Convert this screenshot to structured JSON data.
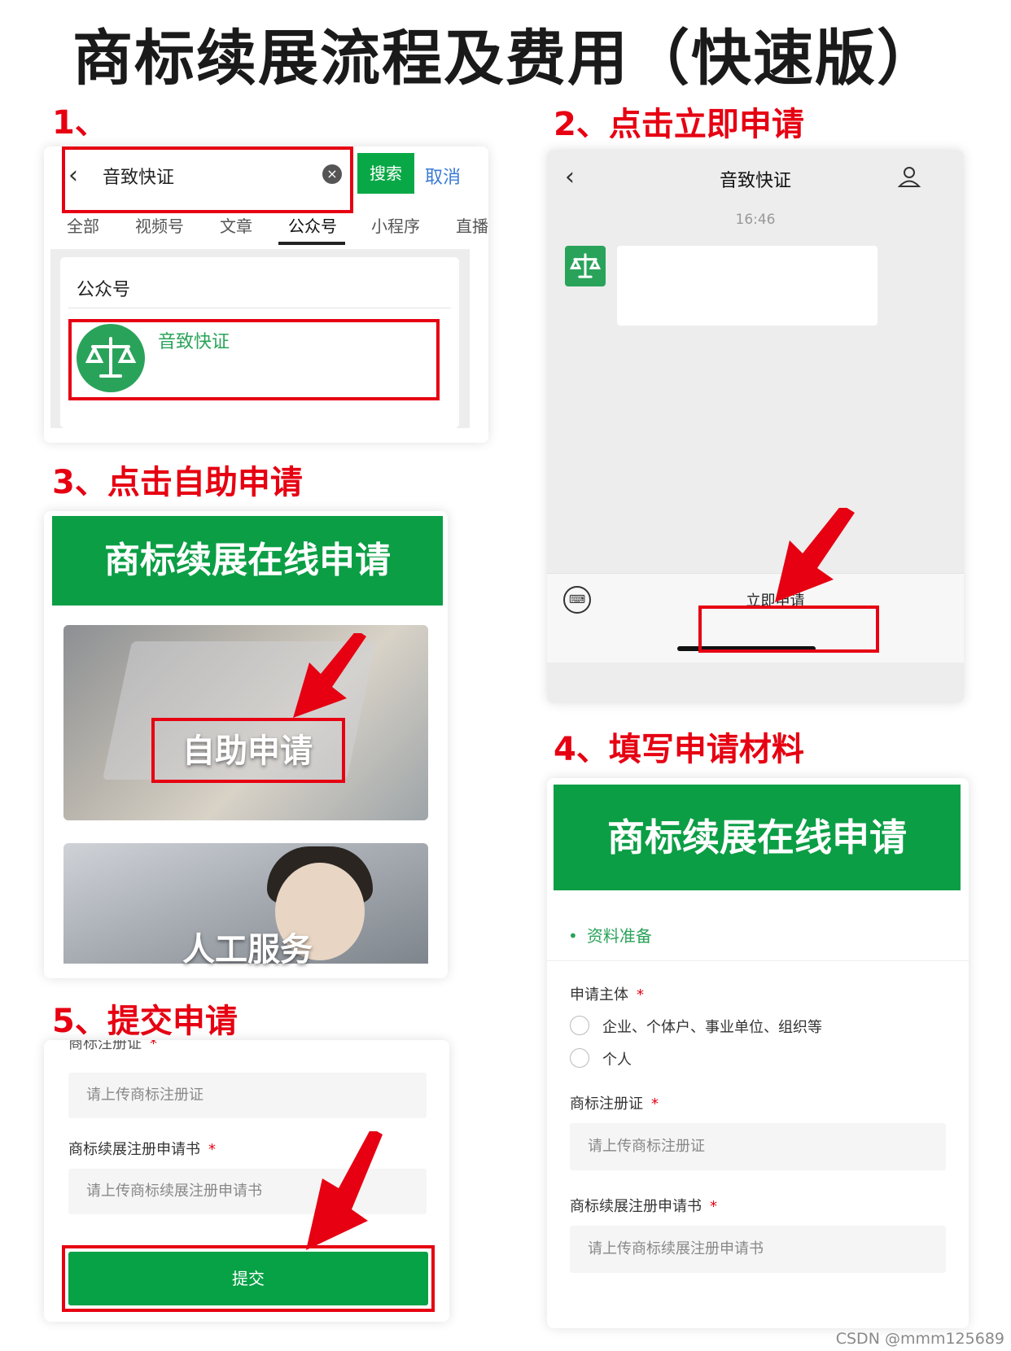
{
  "title": "商标续展流程及费用（快速版）",
  "steps": {
    "s1": "1、",
    "s2": "2、点击立即申请",
    "s3": "3、点击自助申请",
    "s4": "4、填写申请材料",
    "s5": "5、提交申请"
  },
  "panel1": {
    "back_icon": "chevron-left-icon",
    "search_query": "音致快证",
    "search_button": "搜索",
    "cancel": "取消",
    "tabs": [
      "全部",
      "视频号",
      "文章",
      "公众号",
      "小程序",
      "直播"
    ],
    "active_tab": "公众号",
    "section_title": "公众号",
    "account_name": "音致快证"
  },
  "panel2": {
    "chat_title": "音致快证",
    "time": "16:46",
    "apply_button": "立即申请",
    "icons": [
      "chevron-left-icon",
      "user-icon",
      "keyboard-icon",
      "scale-icon"
    ]
  },
  "panel3": {
    "banner": "商标续展在线申请",
    "self_service": "自助申请",
    "manual_service": "人工服务"
  },
  "panel4": {
    "banner": "商标续展在线申请",
    "section": "资料准备",
    "applicant_label": "申请主体",
    "required_mark": "*",
    "option1": "企业、个体户、事业单位、组织等",
    "option2": "个人",
    "cert_label": "商标注册证",
    "cert_placeholder": "请上传商标注册证",
    "renewal_label": "商标续展注册申请书",
    "renewal_placeholder": "请上传商标续展注册申请书"
  },
  "panel5": {
    "cut_label": "商标注册证",
    "cert_placeholder": "请上传商标注册证",
    "renewal_label": "商标续展注册申请书",
    "renewal_placeholder": "请上传商标续展注册申请书",
    "submit": "提交"
  },
  "watermark": "CSDN @mmm125689",
  "colors": {
    "accent_green": "#0b9e45",
    "highlight_red": "#e60012"
  }
}
